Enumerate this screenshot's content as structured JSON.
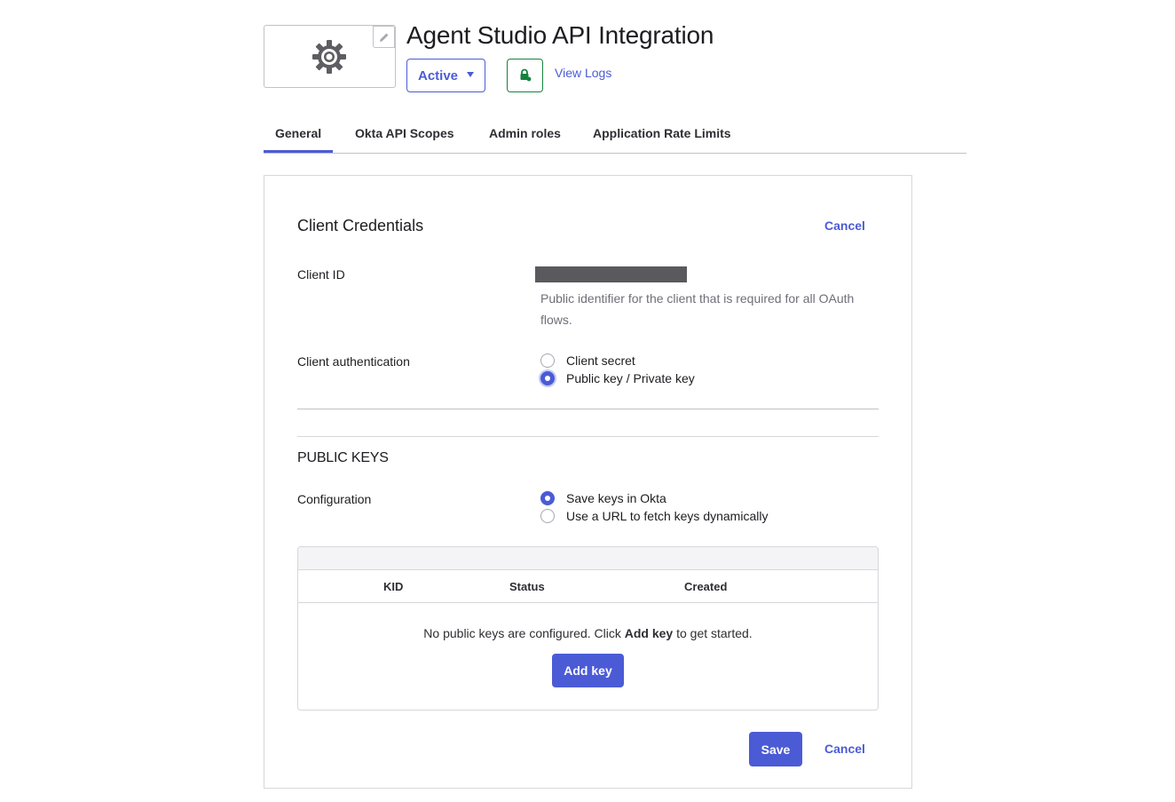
{
  "app": {
    "title": "Agent Studio API Integration",
    "logo_icon": "gear-icon",
    "status": "Active",
    "view_logs": "View Logs"
  },
  "tabs": [
    {
      "label": "General",
      "active": true
    },
    {
      "label": "Okta API Scopes",
      "active": false
    },
    {
      "label": "Admin roles",
      "active": false
    },
    {
      "label": "Application Rate Limits",
      "active": false
    }
  ],
  "credentials": {
    "title": "Client Credentials",
    "cancel_label": "Cancel",
    "client_id_label": "Client ID",
    "client_id_help": "Public identifier for the client that is required for all OAuth flows.",
    "auth_label": "Client authentication",
    "auth_options": [
      {
        "label": "Client secret",
        "checked": false
      },
      {
        "label": "Public key / Private key",
        "checked": true
      }
    ]
  },
  "public_keys": {
    "title": "PUBLIC KEYS",
    "config_label": "Configuration",
    "config_options": [
      {
        "label": "Save keys in Okta",
        "checked": true
      },
      {
        "label": "Use a URL to fetch keys dynamically",
        "checked": false
      }
    ],
    "table": {
      "columns": [
        "KID",
        "Status",
        "Created"
      ],
      "empty_prefix": "No public keys are configured. Click ",
      "empty_bold": "Add key",
      "empty_suffix": " to get started.",
      "add_key_label": "Add key"
    }
  },
  "footer": {
    "save_label": "Save",
    "cancel_label": "Cancel"
  },
  "colors": {
    "accent": "#4b5bd6",
    "success": "#16823f",
    "border": "#c1c1c8"
  }
}
